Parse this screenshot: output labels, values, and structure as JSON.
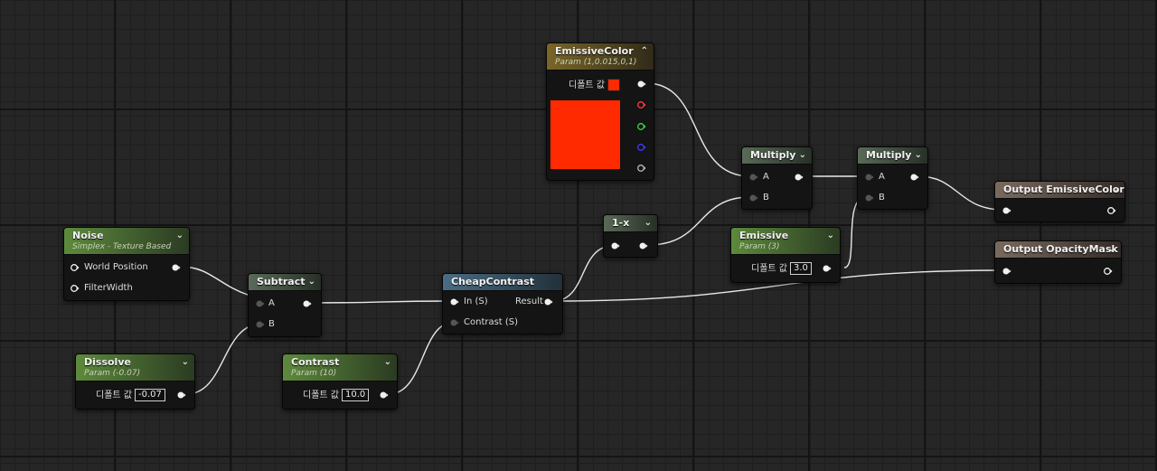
{
  "colors": {
    "emissive": "#ff2a00",
    "wire": "#e8e8e8",
    "pin_r": "#ff3c3c",
    "pin_g": "#3cdc3c",
    "pin_b": "#3c3cff",
    "pin_a": "#b8b8b8"
  },
  "nodes": {
    "noise": {
      "title": "Noise",
      "subtitle": "Simplex - Texture Based",
      "pins": [
        "World Position",
        "FilterWidth"
      ]
    },
    "dissolve": {
      "title": "Dissolve",
      "subtitle": "Param (-0.07)",
      "default_label": "디폴트 값",
      "value": "-0.07"
    },
    "subtract": {
      "title": "Subtract",
      "pin_a": "A",
      "pin_b": "B"
    },
    "contrast": {
      "title": "Contrast",
      "subtitle": "Param (10)",
      "default_label": "디폴트 값",
      "value": "10.0"
    },
    "cheapcontrast": {
      "title": "CheapContrast",
      "pin_in": "In (S)",
      "pin_contrast": "Contrast (S)",
      "pin_result": "Result"
    },
    "one_minus": {
      "title": "1-x"
    },
    "emissive_color": {
      "title": "EmissiveColor",
      "subtitle": "Param (1,0.015,0,1)",
      "default_label": "디폴트 값"
    },
    "multiply1": {
      "title": "Multiply",
      "pin_a": "A",
      "pin_b": "B"
    },
    "multiply2": {
      "title": "Multiply",
      "pin_a": "A",
      "pin_b": "B"
    },
    "emissive": {
      "title": "Emissive",
      "subtitle": "Param (3)",
      "default_label": "디폴트 값",
      "value": "3.0"
    },
    "output_emissive": {
      "title": "Output EmissiveColor"
    },
    "output_opacity": {
      "title": "Output OpacityMask"
    }
  }
}
